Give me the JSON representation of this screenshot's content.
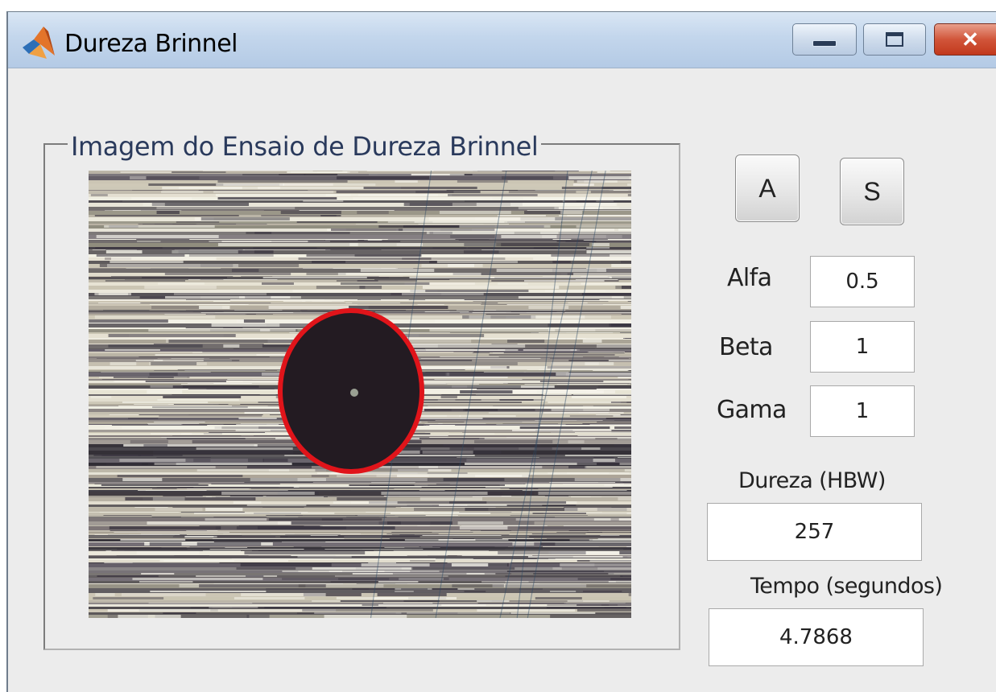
{
  "window": {
    "title": "Dureza Brinnel",
    "icon": "matlab-icon",
    "controls": [
      "minimize-icon",
      "maximize-icon",
      "close-icon"
    ]
  },
  "panel": {
    "title": "Imagem do Ensaio de Dureza Brinnel",
    "image_description_icon": "brinell-indentation-image"
  },
  "buttons": {
    "a_label": "A",
    "s_label": "S"
  },
  "params": {
    "alfa_label": "Alfa",
    "alfa_value": "0.5",
    "beta_label": "Beta",
    "beta_value": "1",
    "gama_label": "Gama",
    "gama_value": "1"
  },
  "results": {
    "dureza_label": "Dureza (HBW)",
    "dureza_value": "257",
    "tempo_label": "Tempo (segundos)",
    "tempo_value": "4.7868"
  },
  "colors": {
    "indent_outline": "#e0141a",
    "indent_fill": "#231b22",
    "title_text": "#2a3a5c"
  }
}
